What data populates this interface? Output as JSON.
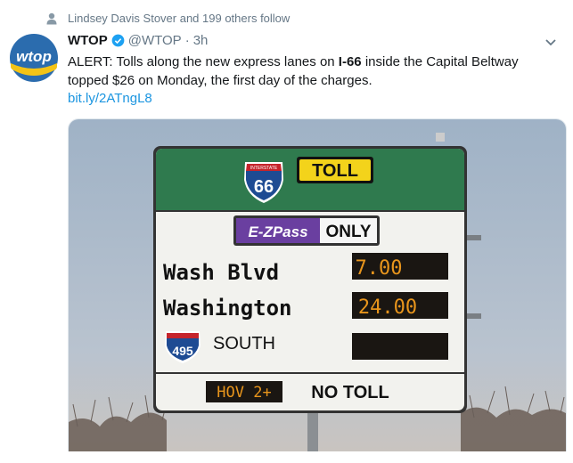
{
  "social_context": {
    "text": "Lindsey Davis Stover and 199 others follow"
  },
  "author": {
    "name": "WTOP",
    "handle": "@WTOP",
    "separator": "·",
    "time": "3h",
    "avatar_text": "wtop"
  },
  "tweet": {
    "text_before": "ALERT: Tolls along the new express lanes on ",
    "text_bold": "I-66",
    "text_after": " inside the Capital Beltway topped $26 on Monday, the first day of the charges.",
    "link": "bit.ly/2ATngL8"
  },
  "sign": {
    "interstate_small": "INTERSTATE",
    "interstate_number": "66",
    "toll_label": "TOLL",
    "ezpass_label": "E-ZPass",
    "only_label": "ONLY",
    "row1_label": "Wash Blvd",
    "row1_price": "7.00",
    "row2_label": "Washington",
    "row2_price": "24.00",
    "shield2_number": "495",
    "row3_label": "SOUTH",
    "hov_label": "HOV 2+",
    "no_toll_label": "NO TOLL"
  },
  "colors": {
    "link": "#1b95e0",
    "verified": "#1da1f2",
    "sign_green": "#2f7a4e",
    "led": "#e8951c"
  }
}
